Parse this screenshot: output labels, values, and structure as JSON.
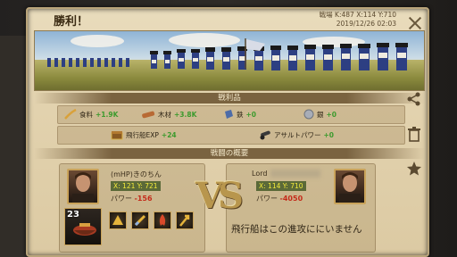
{
  "window": {
    "title": "勝利！",
    "info_line1": "戦場 K:487 X:114 Y:710",
    "info_line2": "2019/12/26 02:03"
  },
  "spoils": {
    "heading": "戦利品",
    "items": [
      {
        "label": "食料",
        "value": "+1.9K",
        "icon": "wheat-icon"
      },
      {
        "label": "木材",
        "value": "+3.8K",
        "icon": "wood-icon"
      },
      {
        "label": "鉄",
        "value": "+0",
        "icon": "iron-icon"
      },
      {
        "label": "銀",
        "value": "+0",
        "icon": "silver-icon"
      }
    ],
    "items2": [
      {
        "label": "飛行船EXP",
        "value": "+24",
        "icon": "treasure-chest-icon"
      },
      {
        "label": "アサルトパワー",
        "value": "+0",
        "icon": "cannon-icon"
      }
    ]
  },
  "summary": {
    "heading": "戦闘の概要",
    "attacker": {
      "name": "(mHP)きのちん",
      "coords": "X: 121 Y: 721",
      "power_label": "パワー",
      "power_value": "-156",
      "ship_level": "23"
    },
    "vs": "VS",
    "defender": {
      "name": "Lord",
      "coords": "X: 114 Y: 710",
      "power_label": "パワー",
      "power_value": "-4050",
      "note": "飛行船はこの進攻ににいません"
    }
  },
  "colors": {
    "positive": "#3c9a2d",
    "negative": "#c42b1a",
    "coords": "#f4ea3a"
  }
}
